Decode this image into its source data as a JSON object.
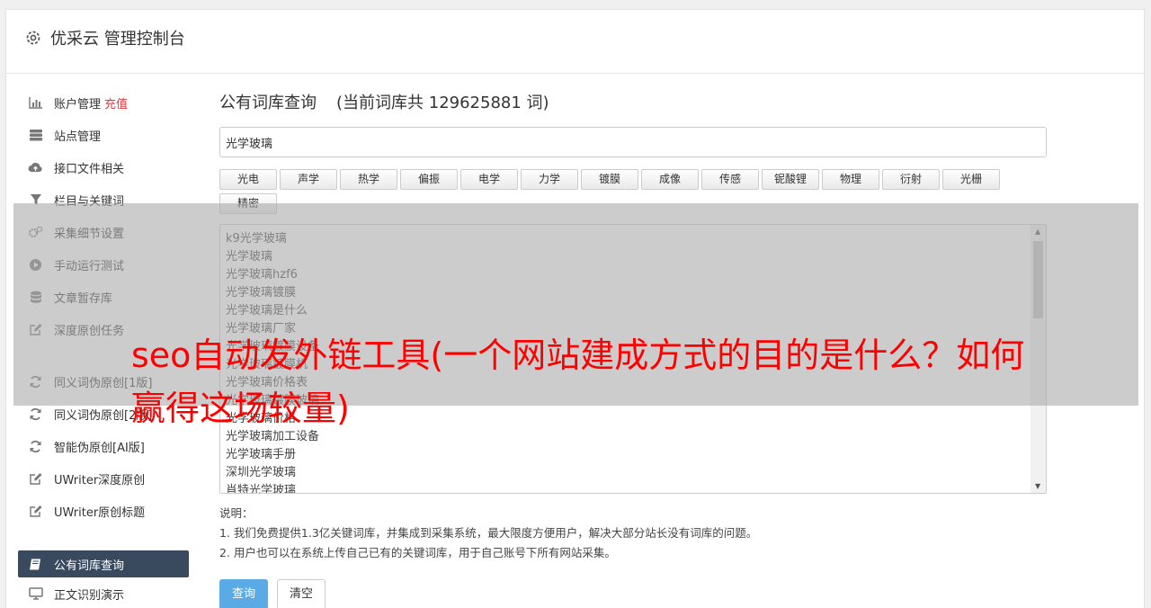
{
  "app": {
    "title": "优采云 管理控制台"
  },
  "sidebar": {
    "group1": [
      {
        "label": "账户管理",
        "badge": "充值",
        "icon": "bar-chart-icon"
      },
      {
        "label": "站点管理",
        "icon": "server-icon"
      },
      {
        "label": "接口文件相关",
        "icon": "cloud-upload-icon"
      },
      {
        "label": "栏目与关键词",
        "icon": "filter-icon"
      },
      {
        "label": "采集细节设置",
        "icon": "gears-icon"
      },
      {
        "label": "手动运行测试",
        "icon": "play-circle-icon"
      },
      {
        "label": "文章暂存库",
        "icon": "database-icon"
      },
      {
        "label": "深度原创任务",
        "icon": "edit-icon"
      }
    ],
    "group2": [
      {
        "label": "同义词伪原创[1版]",
        "icon": "refresh-icon"
      },
      {
        "label": "同义词伪原创[2版]",
        "icon": "refresh-icon"
      },
      {
        "label": "智能伪原创[AI版]",
        "icon": "refresh-icon"
      },
      {
        "label": "UWriter深度原创",
        "icon": "edit-icon"
      },
      {
        "label": "UWriter原创标题",
        "icon": "edit-icon"
      }
    ],
    "group3": [
      {
        "label": "公有词库查询",
        "icon": "book-icon",
        "active": true
      },
      {
        "label": "正文识别演示",
        "icon": "monitor-icon"
      }
    ]
  },
  "main": {
    "heading": "公有词库查询",
    "count_text": "(当前词库共 129625881 词)",
    "search_value": "光学玻璃",
    "tags": [
      "光电",
      "声学",
      "热学",
      "偏振",
      "电学",
      "力学",
      "镀膜",
      "成像",
      "传感",
      "铌酸锂",
      "物理",
      "衍射",
      "光栅",
      "精密"
    ],
    "results": [
      "k9光学玻璃",
      "光学玻璃",
      "光学玻璃hzf6",
      "光学玻璃镀膜",
      "光学玻璃是什么",
      "光学玻璃厂家",
      "光学玻璃镀膜设备",
      "光学玻璃镀膜机",
      "光学玻璃价格表",
      "光学玻璃镀膜玻璃",
      "光学玻璃价格",
      "光学玻璃加工设备",
      "光学玻璃手册",
      "深圳光学玻璃",
      "肖特光学玻璃"
    ],
    "notes_title": "说明：",
    "notes": [
      "1. 我们免费提供1.3亿关键词库，并集成到采集系统，最大限度方便用户，解决大部分站长没有词库的问题。",
      "2. 用户也可以在系统上传自己已有的关键词库，用于自己账号下所有网站采集。"
    ],
    "query_button": "查询",
    "clear_button": "清空"
  },
  "overlay": {
    "banner_text": "seo自动发外链工具(一个网站建成方式的目的是什么？如何赢得这场较量)"
  },
  "colors": {
    "active_nav": "#394a5f",
    "primary": "#5aaae6",
    "badge": "#e4393c",
    "banner": "#ff0000"
  }
}
